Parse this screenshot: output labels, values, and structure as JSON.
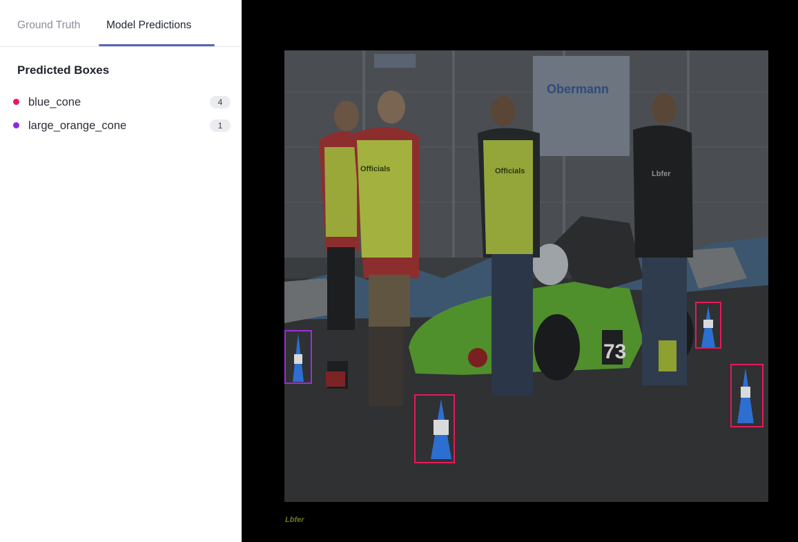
{
  "tabs": [
    {
      "label": "Ground Truth"
    },
    {
      "label": "Model Predictions",
      "active": true
    }
  ],
  "section_title": "Predicted Boxes",
  "classes": [
    {
      "name": "blue_cone",
      "count": "4",
      "color": "#e8195a"
    },
    {
      "name": "large_orange_cone",
      "count": "1",
      "color": "#8a2be2"
    }
  ],
  "image": {
    "vest_text": "Officials",
    "sign_text": "Obermann",
    "car_number": "73",
    "watermark": "Lbfer"
  }
}
